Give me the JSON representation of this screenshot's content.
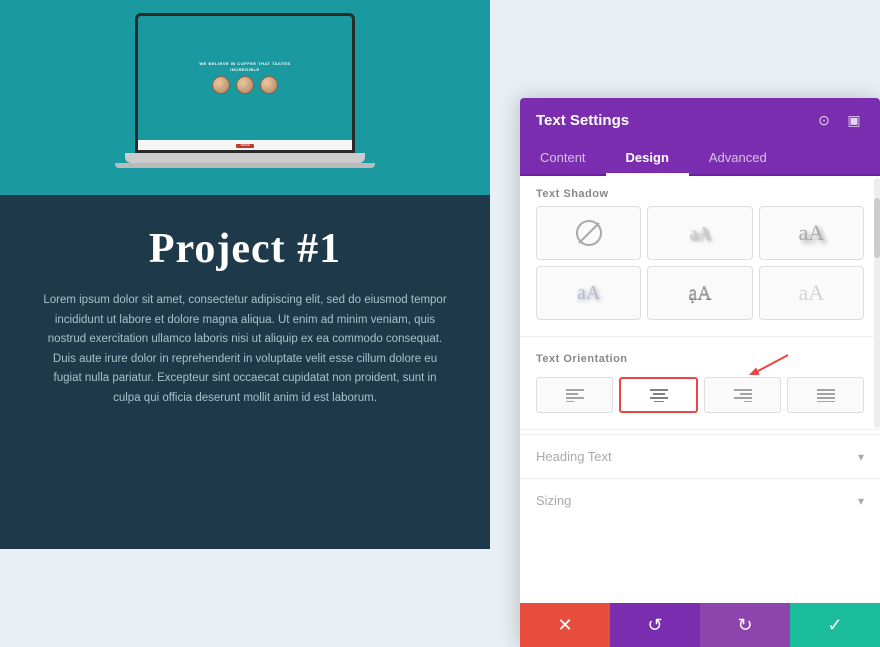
{
  "leftPanel": {
    "projectTitle": "Project #1",
    "description": "Lorem ipsum dolor sit amet, consectetur adipiscing elit, sed do eiusmod tempor incididunt ut labore et dolore magna aliqua. Ut enim ad minim veniam, quis nostrud exercitation ullamco laboris nisi ut aliquip ex ea commodo consequat. Duis aute irure dolor in reprehenderit in voluptate velit esse cillum dolore eu fugiat nulla pariatur. Excepteur sint occaecat cupidatat non proident, sunt in culpa qui officia deserunt mollit anim id est laborum.",
    "laptopHeader1": "WE BELIEVE IN COFFEE THAT TASTES",
    "laptopHeader2": "INCREDIBLE"
  },
  "rightPanel": {
    "title": "Text Settings",
    "tabs": [
      {
        "id": "content",
        "label": "Content"
      },
      {
        "id": "design",
        "label": "Design",
        "active": true
      },
      {
        "id": "advanced",
        "label": "Advanced"
      }
    ],
    "textShadowLabel": "Text Shadow",
    "textOrientationLabel": "Text Orientation",
    "shadowOptions": [
      {
        "id": "none",
        "type": "none"
      },
      {
        "id": "shadow1",
        "type": "shadow1",
        "text": "aA"
      },
      {
        "id": "shadow2",
        "type": "shadow2",
        "text": "aA"
      },
      {
        "id": "shadow3",
        "type": "shadow3",
        "text": "aA"
      },
      {
        "id": "shadow4",
        "type": "shadow4",
        "text": "ạA"
      },
      {
        "id": "shadow5",
        "type": "shadow5",
        "text": "aA"
      }
    ],
    "orientations": [
      {
        "id": "left",
        "icon": "≡",
        "align": "left"
      },
      {
        "id": "center",
        "icon": "≡",
        "align": "center",
        "selected": true
      },
      {
        "id": "right",
        "icon": "≡",
        "align": "right"
      },
      {
        "id": "justify",
        "icon": "≡",
        "align": "justify"
      }
    ],
    "accordions": [
      {
        "id": "heading-text",
        "label": "Heading Text"
      },
      {
        "id": "sizing",
        "label": "Sizing"
      }
    ],
    "toolbar": {
      "cancelLabel": "✕",
      "undoLabel": "↺",
      "redoLabel": "↻",
      "saveLabel": "✓"
    }
  }
}
